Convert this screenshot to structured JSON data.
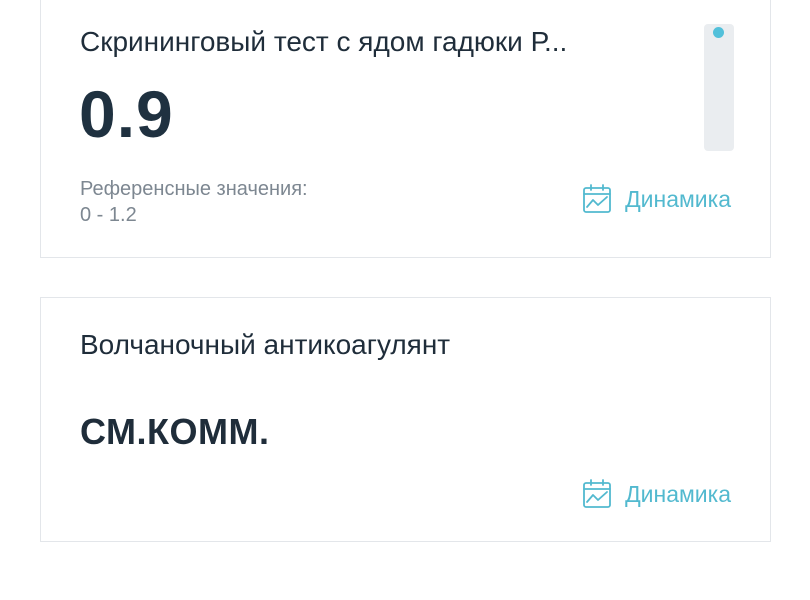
{
  "results": [
    {
      "title": "Скрининговый тест с ядом гадюки Р...",
      "value": "0.9",
      "reference_label": "Референсные значения:",
      "reference_range": "0 - 1.2",
      "dynamics_label": "Динамика",
      "dynamics_icon": "calendar-chart-icon"
    },
    {
      "title": "Волчаночный антикоагулянт",
      "value": "СМ.КОММ.",
      "dynamics_label": "Динамика",
      "dynamics_icon": "calendar-chart-icon"
    }
  ],
  "colors": {
    "accent": "#52b9cf",
    "title": "#1f2d3a",
    "muted": "#7d8791",
    "scale_track": "#eaedf0",
    "scale_marker": "#52c0da"
  }
}
